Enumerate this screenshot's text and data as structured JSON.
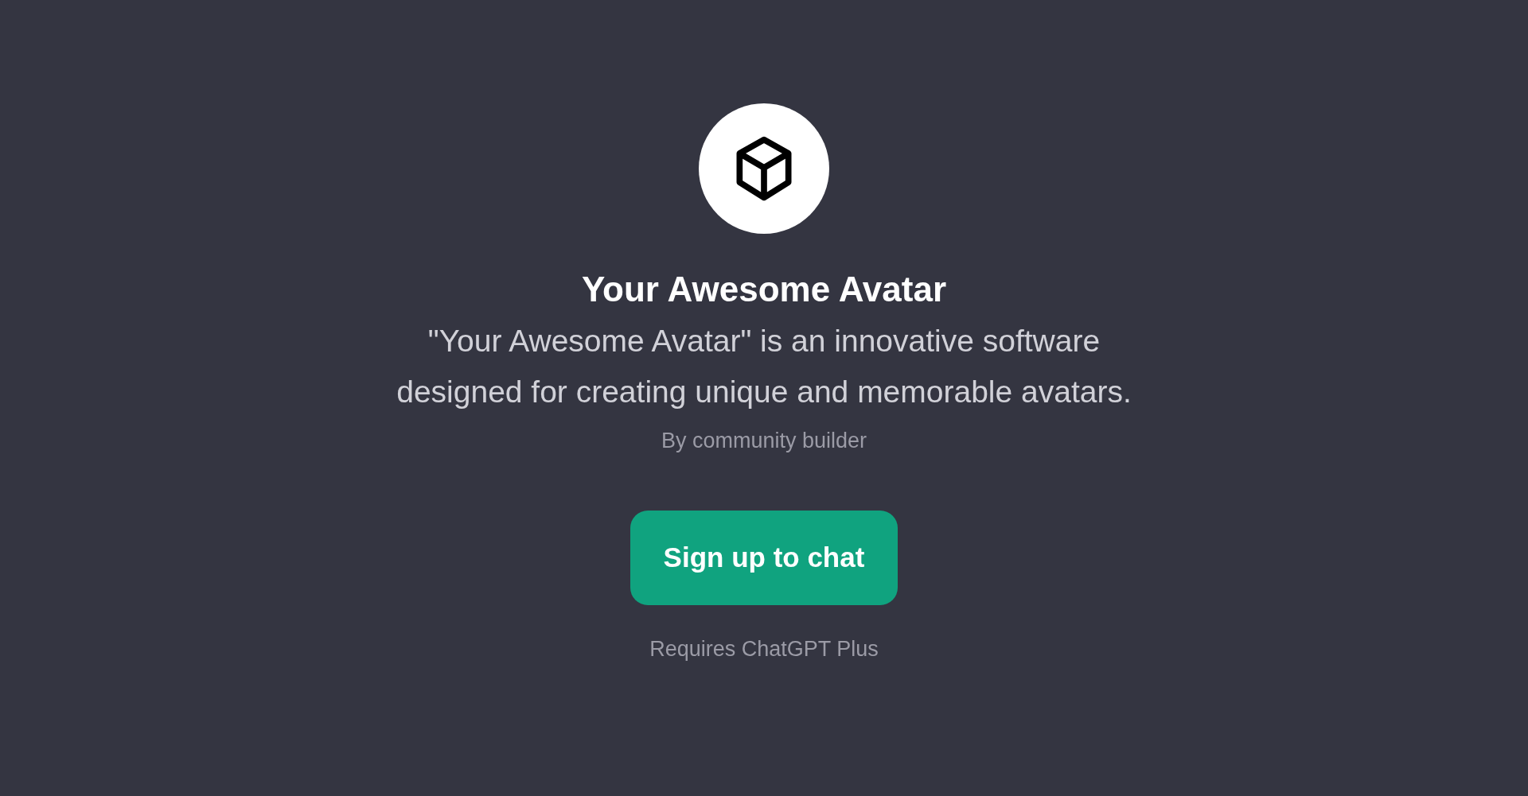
{
  "gpt": {
    "title": "Your Awesome Avatar",
    "description": "\"Your Awesome Avatar\" is an innovative software designed for creating unique and memorable avatars.",
    "byline": "By community builder"
  },
  "signup_button": {
    "label": "Sign up to chat"
  },
  "footnote": "Requires ChatGPT Plus"
}
